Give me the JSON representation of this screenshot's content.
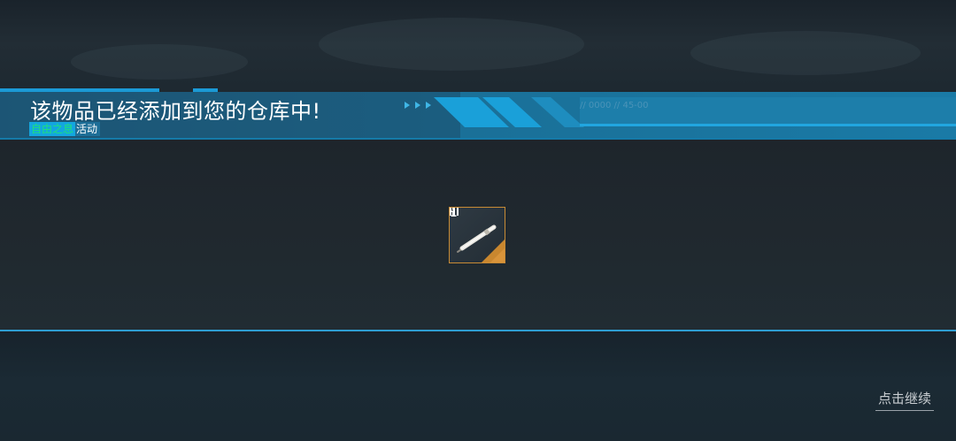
{
  "banner": {
    "title": "该物品已经添加到您的仓库中!",
    "event_name": "自由之息",
    "event_type": "活动",
    "code_text": "// 0000 // 45-00",
    "accent_color": "#1b8fc4"
  },
  "item": {
    "name_icon": "pen-icon",
    "rarity_color": "#c88b35",
    "tier_icon": "tier-3-icon",
    "info_icon": "info-icon"
  },
  "footer": {
    "continue_label": "点击继续"
  }
}
